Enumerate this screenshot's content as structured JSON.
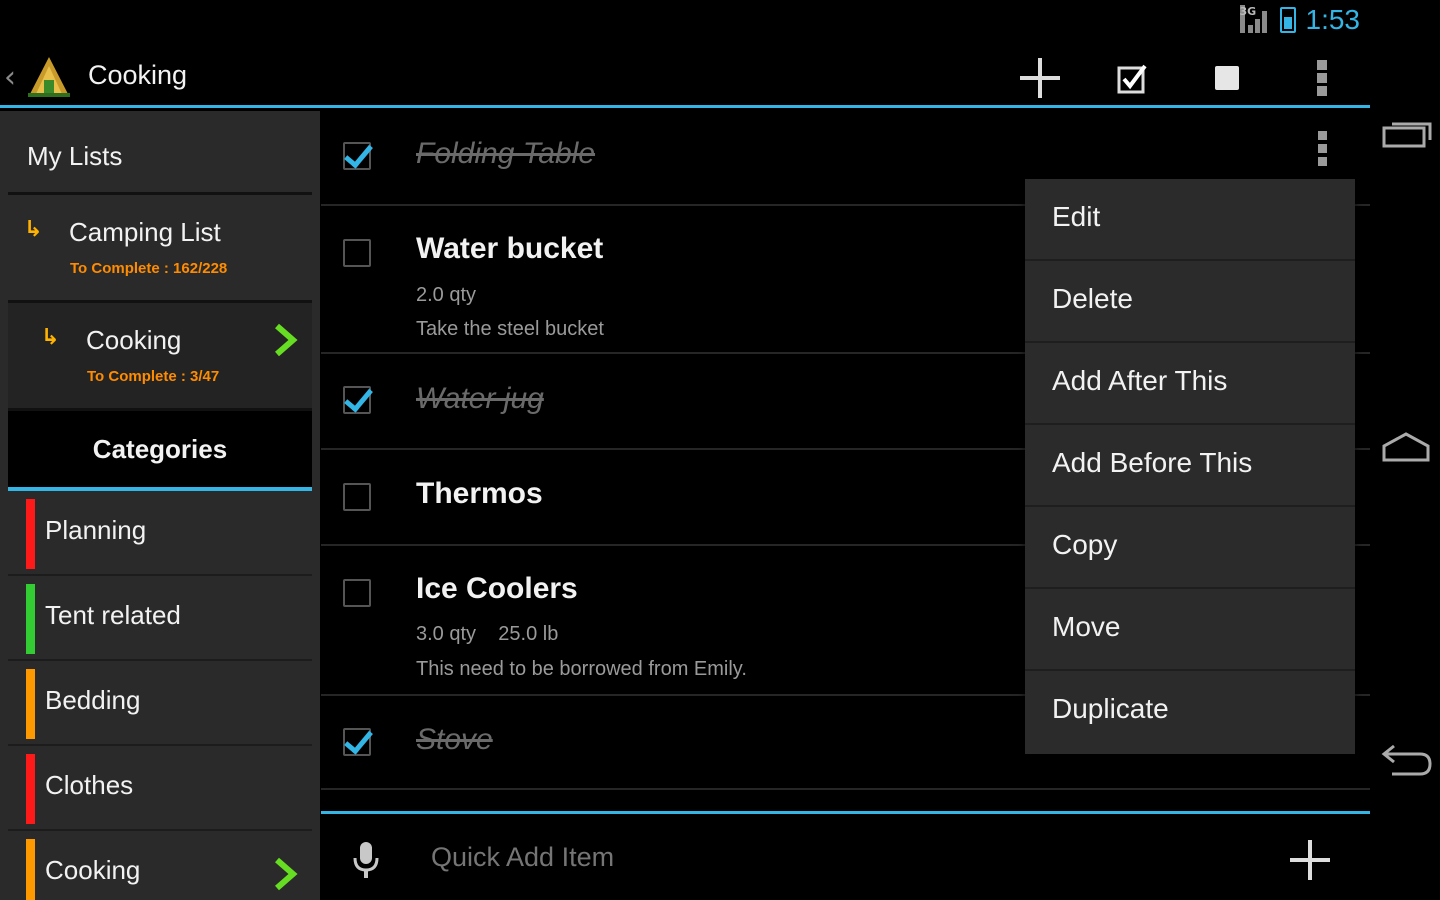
{
  "status_bar": {
    "time": "1:53",
    "network": "3G"
  },
  "action_bar": {
    "title": "Cooking"
  },
  "sidebar": {
    "header": "My Lists",
    "lists": [
      {
        "name": "Camping List",
        "progress": "To Complete : 162/228"
      },
      {
        "name": "Cooking",
        "progress": "To Complete : 3/47"
      }
    ],
    "categories_title": "Categories",
    "categories": [
      {
        "name": "Planning",
        "color": "#ff1a1a"
      },
      {
        "name": "Tent related",
        "color": "#33cc33"
      },
      {
        "name": "Bedding",
        "color": "#ff9900"
      },
      {
        "name": "Clothes",
        "color": "#ff1a1a"
      },
      {
        "name": "Cooking",
        "color": "#ff9900"
      }
    ]
  },
  "items": [
    {
      "title": "Folding Table",
      "checked": true
    },
    {
      "title": "Water bucket",
      "checked": false,
      "detail1": "2.0 qty",
      "detail2": "Take the steel bucket"
    },
    {
      "title": "Water jug",
      "checked": true
    },
    {
      "title": "Thermos",
      "checked": false
    },
    {
      "title": "Ice Coolers",
      "checked": false,
      "detail1": "3.0 qty    25.0 lb",
      "detail2": "This need to be borrowed from Emily."
    },
    {
      "title": "Stove",
      "checked": true
    }
  ],
  "popup_menu": [
    "Edit",
    "Delete",
    "Add After This",
    "Add Before This",
    "Copy",
    "Move",
    "Duplicate"
  ],
  "quick_add": {
    "placeholder": "Quick Add Item"
  },
  "colors": {
    "accent": "#33b5e5",
    "list_arrow": "#ffb300",
    "progress_text": "#ff8c00",
    "chevron": "#66dd22"
  }
}
